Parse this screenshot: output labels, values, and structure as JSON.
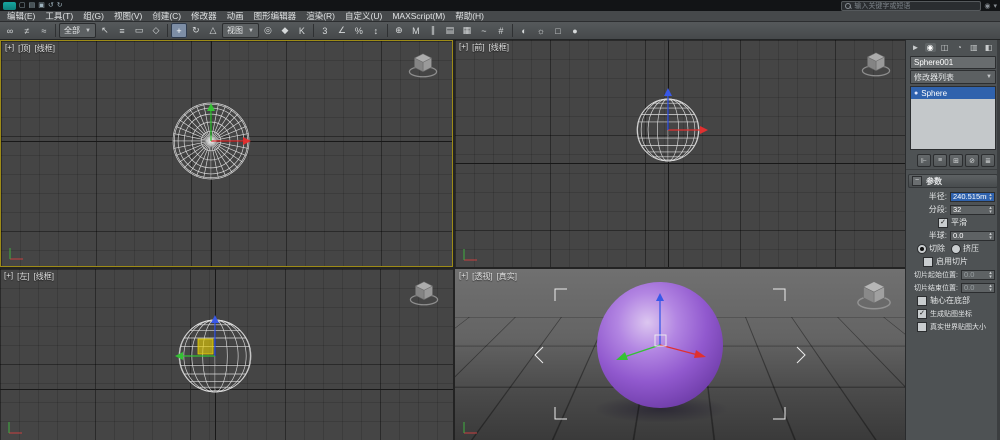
{
  "glyphs": {
    "check": "✓",
    "dropdown": "▼",
    "spin_up": "▴",
    "spin_down": "▾",
    "collapse": "−"
  },
  "titlebar": {
    "search_placeholder": "输入关键字或短语",
    "quick_icons": [
      {
        "name": "new-scene-icon",
        "glyph": "▢"
      },
      {
        "name": "open-file-icon",
        "glyph": "▤"
      },
      {
        "name": "save-file-icon",
        "glyph": "▣"
      },
      {
        "name": "undo-icon",
        "glyph": "↺"
      },
      {
        "name": "redo-icon",
        "glyph": "↻"
      }
    ],
    "right_icons": [
      {
        "name": "sign-in-icon",
        "glyph": "◉"
      },
      {
        "name": "help-menu-icon",
        "glyph": "▾"
      }
    ]
  },
  "menubar": {
    "items": [
      "编辑(E)",
      "工具(T)",
      "组(G)",
      "视图(V)",
      "创建(C)",
      "修改器",
      "动画",
      "图形编辑器",
      "渲染(R)",
      "自定义(U)",
      "MAXScript(M)",
      "帮助(H)"
    ]
  },
  "toolbar": {
    "selection_filter_value": "全部",
    "reference_coordinate_value": "视图",
    "icons": [
      {
        "name": "select-and-link",
        "glyph": "∞"
      },
      {
        "name": "unlink-selection",
        "glyph": "≠"
      },
      {
        "name": "bind-to-space-warp",
        "glyph": "≈"
      },
      {
        "name": "select-object",
        "glyph": "↖"
      },
      {
        "name": "select-by-name",
        "glyph": "≡"
      },
      {
        "name": "rectangular-selection-region",
        "glyph": "▭"
      },
      {
        "name": "window-crossing",
        "glyph": "◇"
      },
      {
        "name": "select-and-move",
        "glyph": "+"
      },
      {
        "name": "select-and-rotate",
        "glyph": "↻"
      },
      {
        "name": "select-and-uniform-scale",
        "glyph": "△"
      },
      {
        "name": "use-pivot-point-center",
        "glyph": "◎"
      },
      {
        "name": "select-and-manipulate",
        "glyph": "◆"
      },
      {
        "name": "keyboard-shortcut-override",
        "glyph": "K"
      },
      {
        "name": "snaps-toggle-3d",
        "glyph": "3"
      },
      {
        "name": "angle-snap-toggle",
        "glyph": "∠"
      },
      {
        "name": "percent-snap-toggle",
        "glyph": "%"
      },
      {
        "name": "spinner-snap-toggle",
        "glyph": "↕"
      },
      {
        "name": "edit-named-selection-sets",
        "glyph": "⊕"
      },
      {
        "name": "mirror",
        "glyph": "M"
      },
      {
        "name": "align",
        "glyph": "∥"
      },
      {
        "name": "layer-manager",
        "glyph": "▤"
      },
      {
        "name": "graphite-ribbon-toggle",
        "glyph": "▦"
      },
      {
        "name": "curve-editor",
        "glyph": "~"
      },
      {
        "name": "schematic-view",
        "glyph": "#"
      },
      {
        "name": "material-editor",
        "glyph": "◐"
      },
      {
        "name": "render-setup",
        "glyph": "☼"
      },
      {
        "name": "rendered-frame-window",
        "glyph": "□"
      },
      {
        "name": "render-production",
        "glyph": "●"
      }
    ]
  },
  "viewports": {
    "top": {
      "plus": "[+]",
      "name": "[顶]",
      "shading": "[线框]"
    },
    "front": {
      "plus": "[+]",
      "name": "[前]",
      "shading": "[线框]"
    },
    "left": {
      "plus": "[+]",
      "name": "[左]",
      "shading": "[线框]"
    },
    "perspective": {
      "plus": "[+]",
      "name": "[透视]",
      "shading": "[真实]"
    }
  },
  "command_panel": {
    "tabs": [
      {
        "name": "create-tab",
        "glyph": "►"
      },
      {
        "name": "modify-tab",
        "glyph": "◉"
      },
      {
        "name": "hierarchy-tab",
        "glyph": "◫"
      },
      {
        "name": "motion-tab",
        "glyph": "◔"
      },
      {
        "name": "display-tab",
        "glyph": "▥"
      },
      {
        "name": "utilities-tab",
        "glyph": "◧"
      }
    ],
    "object_name": "Sphere001",
    "modifier_list_label": "修改器列表",
    "stack_items": [
      {
        "label": "Sphere"
      }
    ],
    "stack_buttons": [
      {
        "name": "pin-stack-icon",
        "glyph": "⊩"
      },
      {
        "name": "show-end-result-icon",
        "glyph": "≡"
      },
      {
        "name": "make-unique-icon",
        "glyph": "⊞"
      },
      {
        "name": "remove-modifier-icon",
        "glyph": "⊘"
      },
      {
        "name": "configure-modifier-sets-icon",
        "glyph": "≣"
      }
    ],
    "parameters": {
      "title": "参数",
      "radius_label": "半径:",
      "radius_value": "240.515mm",
      "segments_label": "分段:",
      "segments_value": "32",
      "smooth_label": "平滑",
      "hemisphere_label": "半球:",
      "hemisphere_value": "0.0",
      "chop_label": "切除",
      "squash_label": "挤压",
      "slice_on_label": "启用切片",
      "slice_from_label": "切片起始位置:",
      "slice_from_value": "0.0",
      "slice_to_label": "切片结束位置:",
      "slice_to_value": "0.0",
      "base_to_pivot_label": "轴心在底部",
      "gen_mapping_label": "生成贴图坐标",
      "real_world_label": "真实世界贴图大小"
    }
  }
}
